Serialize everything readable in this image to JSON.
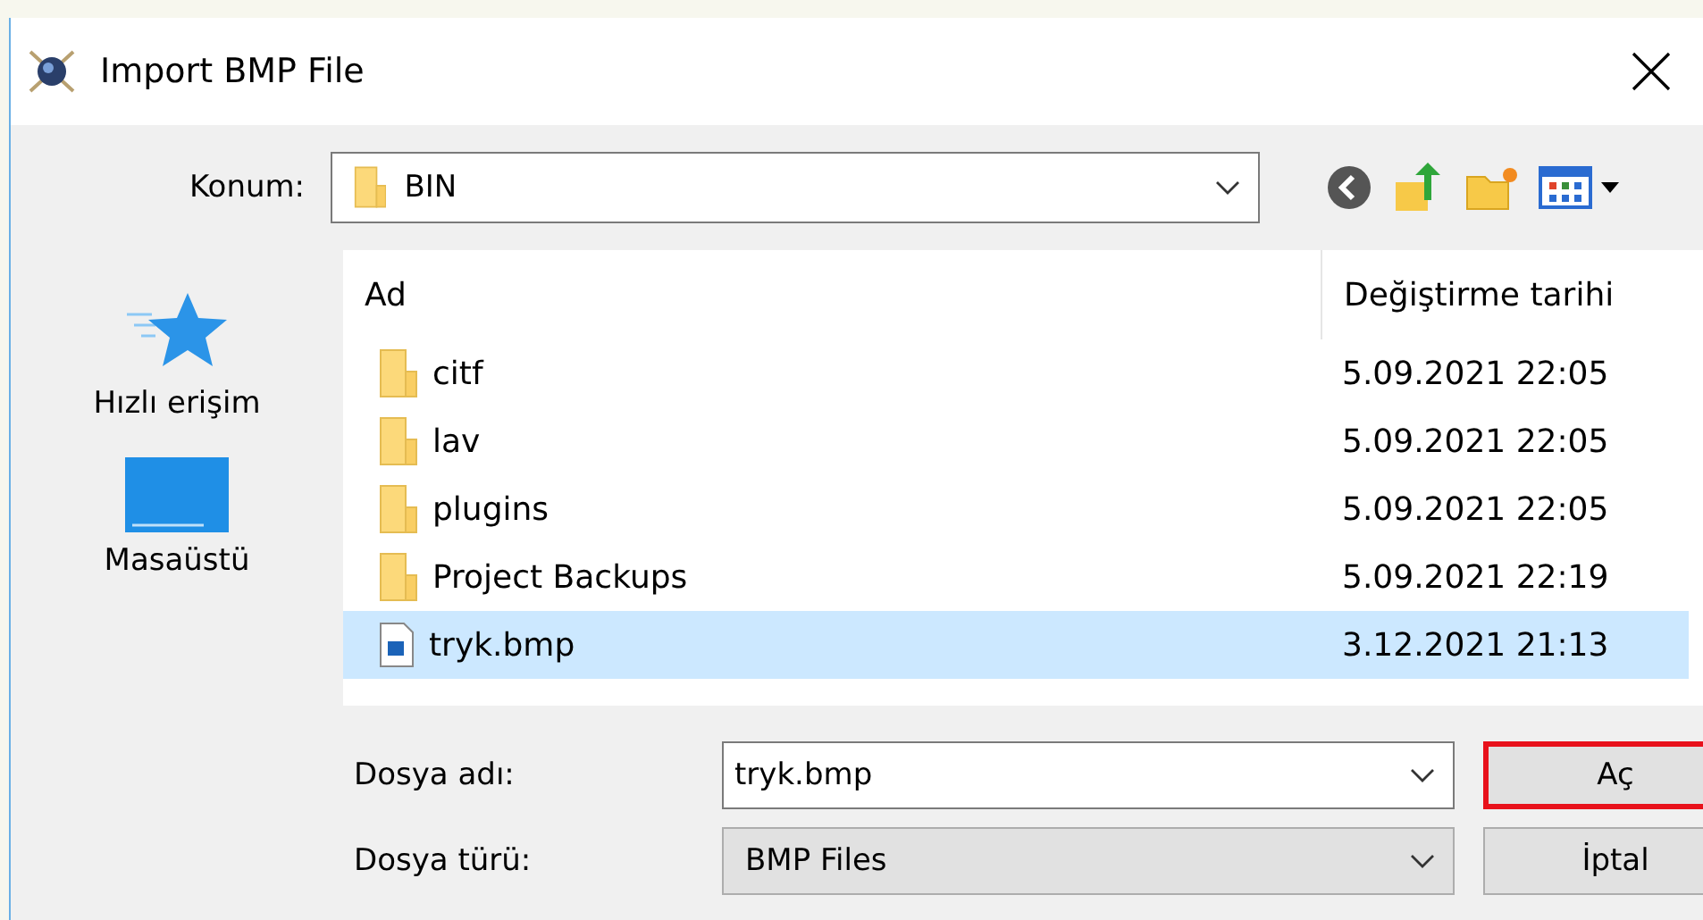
{
  "window": {
    "title": "Import BMP File"
  },
  "location": {
    "label": "Konum:",
    "value": "BIN"
  },
  "sidebar": {
    "items": [
      {
        "label": "Hızlı erişim",
        "kind": "star"
      },
      {
        "label": "Masaüstü",
        "kind": "desktop"
      }
    ]
  },
  "table": {
    "columns": [
      "Ad",
      "Değiştirme tarihi"
    ],
    "rows": [
      {
        "name": "citf",
        "date": "5.09.2021 22:05",
        "kind": "folder",
        "selected": false
      },
      {
        "name": "lav",
        "date": "5.09.2021 22:05",
        "kind": "folder",
        "selected": false
      },
      {
        "name": "plugins",
        "date": "5.09.2021 22:05",
        "kind": "folder",
        "selected": false
      },
      {
        "name": "Project Backups",
        "date": "5.09.2021 22:19",
        "kind": "folder",
        "selected": false
      },
      {
        "name": "tryk.bmp",
        "date": "3.12.2021 21:13",
        "kind": "file",
        "selected": true
      }
    ]
  },
  "file_name": {
    "label": "Dosya adı:",
    "value": "tryk.bmp"
  },
  "file_type": {
    "label": "Dosya türü:",
    "value": "BMP Files"
  },
  "buttons": [
    {
      "label": "Aç",
      "highlighted": true
    },
    {
      "label": "İptal",
      "highlighted": false
    }
  ]
}
